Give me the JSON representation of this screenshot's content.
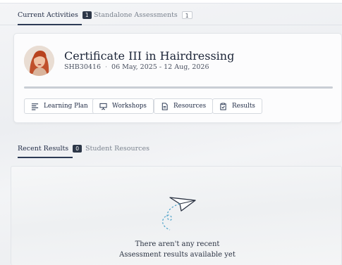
{
  "top_tabs": [
    {
      "label": "Current Activities",
      "count": "1",
      "active": true
    },
    {
      "label": "Standalone Assessments",
      "count": "1",
      "active": false
    }
  ],
  "course": {
    "title": "Certificate III in Hairdressing",
    "code": "SHB30416",
    "separator": "·",
    "dates": "06 May, 2025 - 12 Aug, 2026",
    "progress_fraction": 0.0
  },
  "actions": {
    "learning_plan": "Learning Plan",
    "workshops": "Workshops",
    "resources": "Resources",
    "results": "Results"
  },
  "bottom_tabs": [
    {
      "label": "Recent Results",
      "count": "0",
      "active": true
    },
    {
      "label": "Student Resources",
      "active": false
    }
  ],
  "empty_state": {
    "message": "There aren't any recent Assessment results available yet"
  },
  "colors": {
    "accent": "#2d3b55",
    "progress_track": "#c9ced5"
  }
}
